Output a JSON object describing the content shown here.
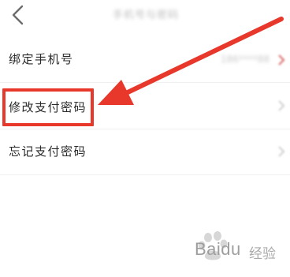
{
  "header": {
    "back_icon": "chevron-left-icon",
    "title": "手机号与密码"
  },
  "menu": {
    "items": [
      {
        "label": "绑定手机号",
        "value": "186****88"
      },
      {
        "label": "修改支付密码"
      },
      {
        "label": "忘记支付密码"
      }
    ]
  },
  "annotation": {
    "box_color": "#e8372b",
    "arrow_color": "#e8372b"
  },
  "watermark": {
    "brand": "Baidu",
    "sub": "经验"
  }
}
